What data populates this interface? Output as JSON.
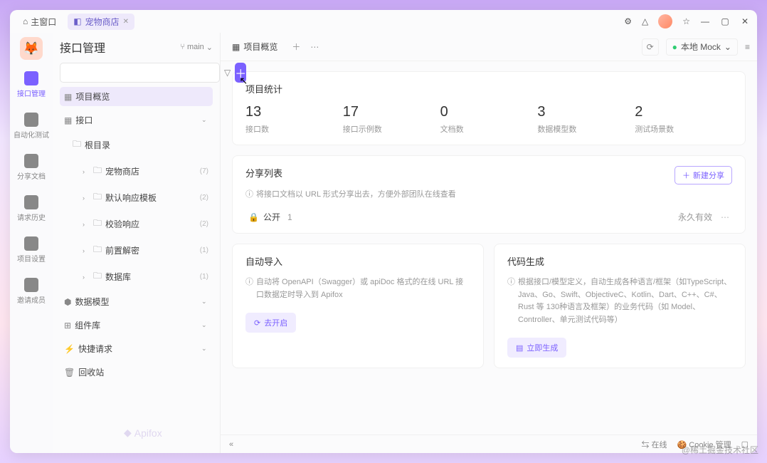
{
  "titlebar": {
    "home_label": "主窗口",
    "project_label": "宠物商店"
  },
  "rail": [
    {
      "icon": "api",
      "label": "接口管理",
      "active": true
    },
    {
      "icon": "robot",
      "label": "自动化测试"
    },
    {
      "icon": "doc",
      "label": "分享文档"
    },
    {
      "icon": "history",
      "label": "请求历史"
    },
    {
      "icon": "settings",
      "label": "项目设置"
    },
    {
      "icon": "user",
      "label": "邀请成员"
    }
  ],
  "sidebar": {
    "title": "接口管理",
    "branch_label": "main",
    "overview_label": "项目概览",
    "interface_label": "接口",
    "root_label": "根目录",
    "folders": [
      {
        "label": "宠物商店",
        "count": "(7)"
      },
      {
        "label": "默认响应模板",
        "count": "(2)"
      },
      {
        "label": "校验响应",
        "count": "(2)"
      },
      {
        "label": "前置解密",
        "count": "(1)"
      },
      {
        "label": "数据库",
        "count": "(1)"
      }
    ],
    "data_model_label": "数据模型",
    "component_label": "组件库",
    "quick_request_label": "快捷请求",
    "recycle_label": "回收站"
  },
  "main_tabs": {
    "overview": "项目概览"
  },
  "env": {
    "label": "本地 Mock"
  },
  "stats": {
    "title": "项目统计",
    "items": [
      {
        "value": "13",
        "label": "接口数"
      },
      {
        "value": "17",
        "label": "接口示例数"
      },
      {
        "value": "0",
        "label": "文档数"
      },
      {
        "value": "3",
        "label": "数据模型数"
      },
      {
        "value": "2",
        "label": "测试场景数"
      }
    ]
  },
  "share": {
    "title": "分享列表",
    "desc": "将接口文档以 URL 形式分享出去，方便外部团队在线查看",
    "new_btn": "新建分享",
    "item_name": "公开",
    "item_count": "1",
    "item_expire": "永久有效"
  },
  "autoimport": {
    "title": "自动导入",
    "desc": "自动将 OpenAPI（Swagger）或 apiDoc 格式的在线 URL 接口数据定时导入到 Apifox",
    "btn": "去开启"
  },
  "codegen": {
    "title": "代码生成",
    "desc": "根据接口/模型定义，自动生成各种语言/框架（如TypeScript、Java、Go、Swift、ObjectiveC、Kotlin、Dart、C++、C#、Rust 等 130种语言及框架）的业务代码（如 Model、Controller、单元测试代码等）",
    "btn": "立即生成"
  },
  "status": {
    "online": "在线",
    "cookie": "Cookie 管理"
  },
  "watermark": "@稀土掘金技术社区",
  "apifox": "Apifox"
}
